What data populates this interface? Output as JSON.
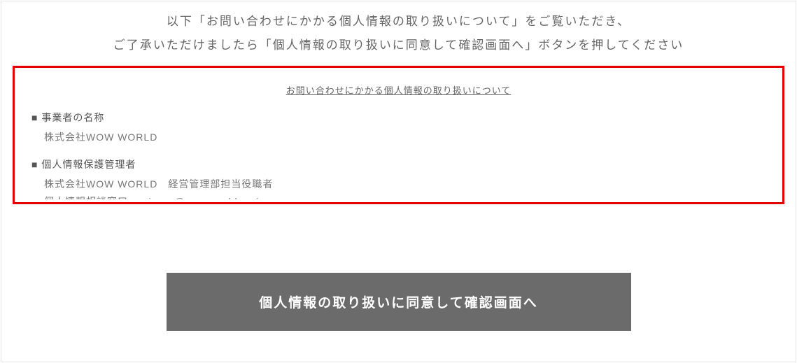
{
  "instruction": {
    "line1": "以下「お問い合わせにかかる個人情報の取り扱いについて」をご覧いただき、",
    "line2": "ご了承いただけましたら「個人情報の取り扱いに同意して確認画面へ」ボタンを押してください"
  },
  "privacy": {
    "title": "お問い合わせにかかる個人情報の取り扱いについて",
    "sections": [
      {
        "heading": "■ 事業者の名称",
        "body": "株式会社WOW WORLD"
      },
      {
        "heading": "■ 個人情報保護管理者",
        "body": "株式会社WOW WORLD　経営管理部担当役職者\n個人情報相談窓口　privacy@wow-world.co.jp"
      }
    ]
  },
  "button": {
    "label": "個人情報の取り扱いに同意して確認画面へ"
  }
}
